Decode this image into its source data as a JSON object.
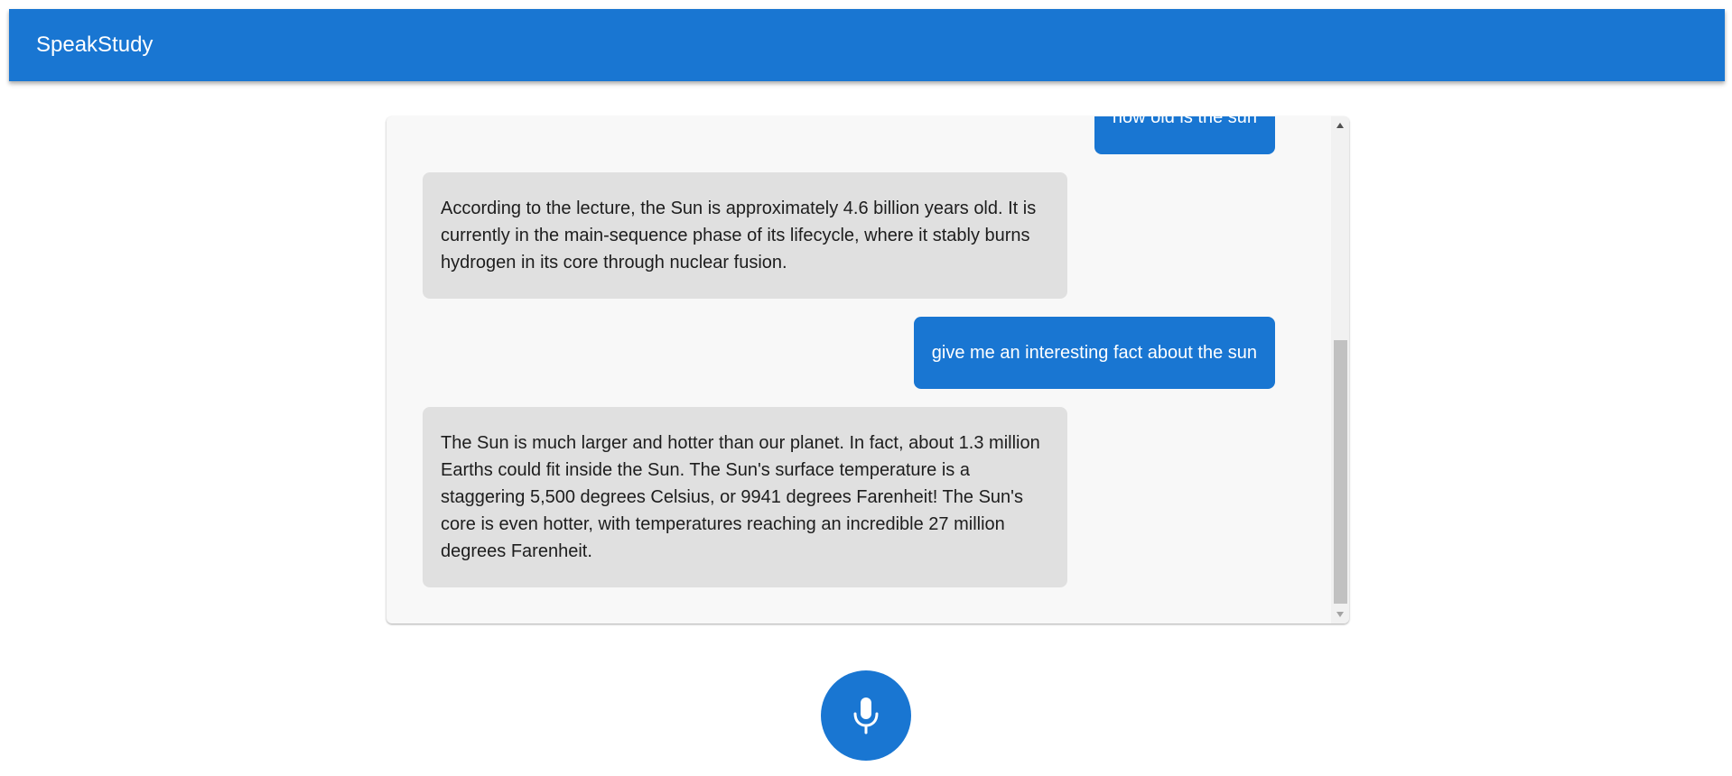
{
  "app": {
    "title": "SpeakStudy"
  },
  "colors": {
    "primary": "#1976d2",
    "user_bubble_text": "#ffffff",
    "bot_bubble": "#e0e0e0",
    "panel_background": "#f8f8f8"
  },
  "chat": {
    "messages": [
      {
        "role": "user",
        "text": "how old is the sun"
      },
      {
        "role": "assistant",
        "text": "According to the lecture, the Sun is approximately 4.6 billion years old. It is currently in the main-sequence phase of its lifecycle, where it stably burns hydrogen in its core through nuclear fusion."
      },
      {
        "role": "user",
        "text": "give me an interesting fact about the sun"
      },
      {
        "role": "assistant",
        "text": "The Sun is much larger and hotter than our planet. In fact, about 1.3 million Earths could fit inside the Sun. The Sun's surface temperature is a staggering 5,500 degrees Celsius, or 9941 degrees Farenheit! The Sun's core is even hotter, with temperatures reaching an incredible 27 million degrees Farenheit."
      }
    ]
  },
  "icons": {
    "mic": "microphone-icon",
    "scroll_up": "caret-up-icon",
    "scroll_down": "caret-down-icon"
  }
}
